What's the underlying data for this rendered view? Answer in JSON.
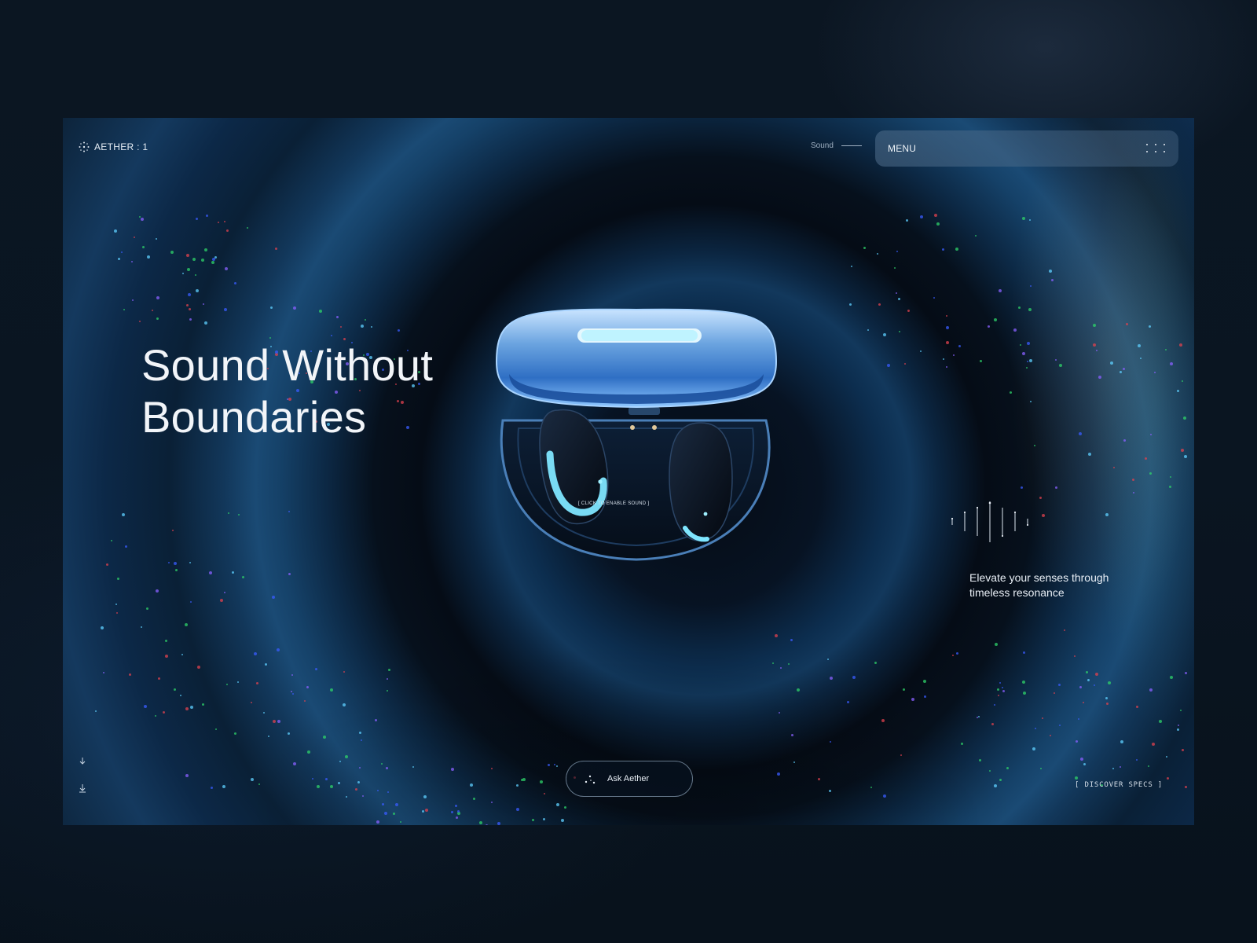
{
  "brand": {
    "name": "AETHER : 1",
    "logo_icon": "crosshair-dots-icon"
  },
  "header": {
    "sound_label": "Sound",
    "menu_label": "MENU",
    "menu_icon": "six-dots-grid-icon"
  },
  "hero": {
    "headline_line1": "Sound Without",
    "headline_line2": "Boundaries",
    "enable_sound_label": "[ CLICK TO ENABLE SOUND ]",
    "tagline": "Elevate your senses through timeless resonance"
  },
  "footer": {
    "ask_label": "Ask Aether",
    "ask_icon": "sparkle-dots-icon",
    "discover_label": "[ DISCOVER SPECS ]",
    "scroll_icon": "arrow-down-icon"
  },
  "colors": {
    "background": "#0a1420",
    "accent_glow": "#7fe6ff",
    "menu_bg": "#4f6e8c"
  }
}
